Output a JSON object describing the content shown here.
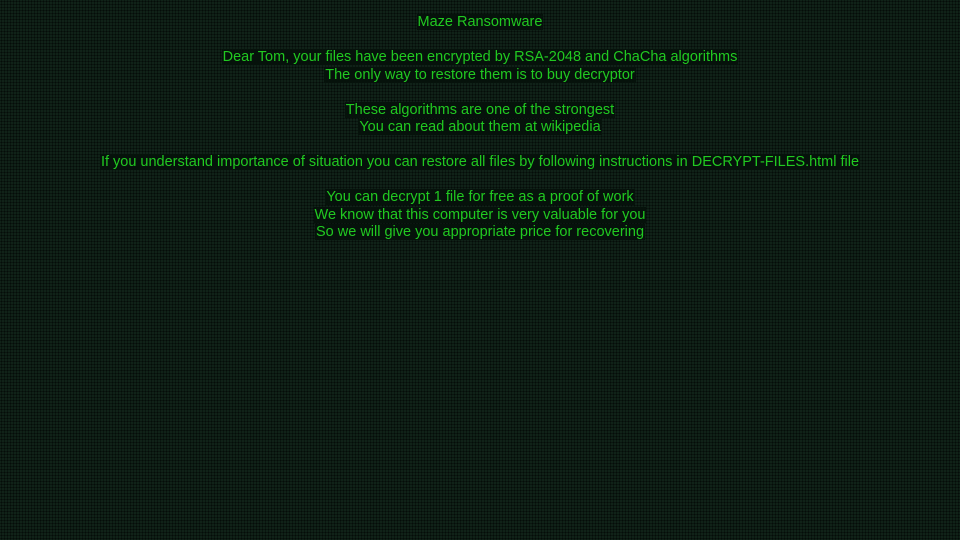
{
  "note": {
    "title": "Maze Ransomware",
    "paragraphs": [
      {
        "lines": [
          "Dear Tom, your files have been encrypted by RSA-2048 and ChaCha algorithms",
          "The only way to restore them is to buy decryptor"
        ]
      },
      {
        "lines": [
          "These algorithms are one of the strongest",
          "You can read about them at wikipedia"
        ]
      },
      {
        "lines": [
          "If you understand importance of situation you can restore all files by following instructions in DECRYPT-FILES.html file"
        ]
      },
      {
        "lines": [
          "You can decrypt 1 file for free as a proof of work",
          "We know that this computer is very valuable for you",
          "So we will give you appropriate price for recovering"
        ]
      }
    ]
  },
  "colors": {
    "text": "#21c921",
    "background": "#0b1a12"
  }
}
